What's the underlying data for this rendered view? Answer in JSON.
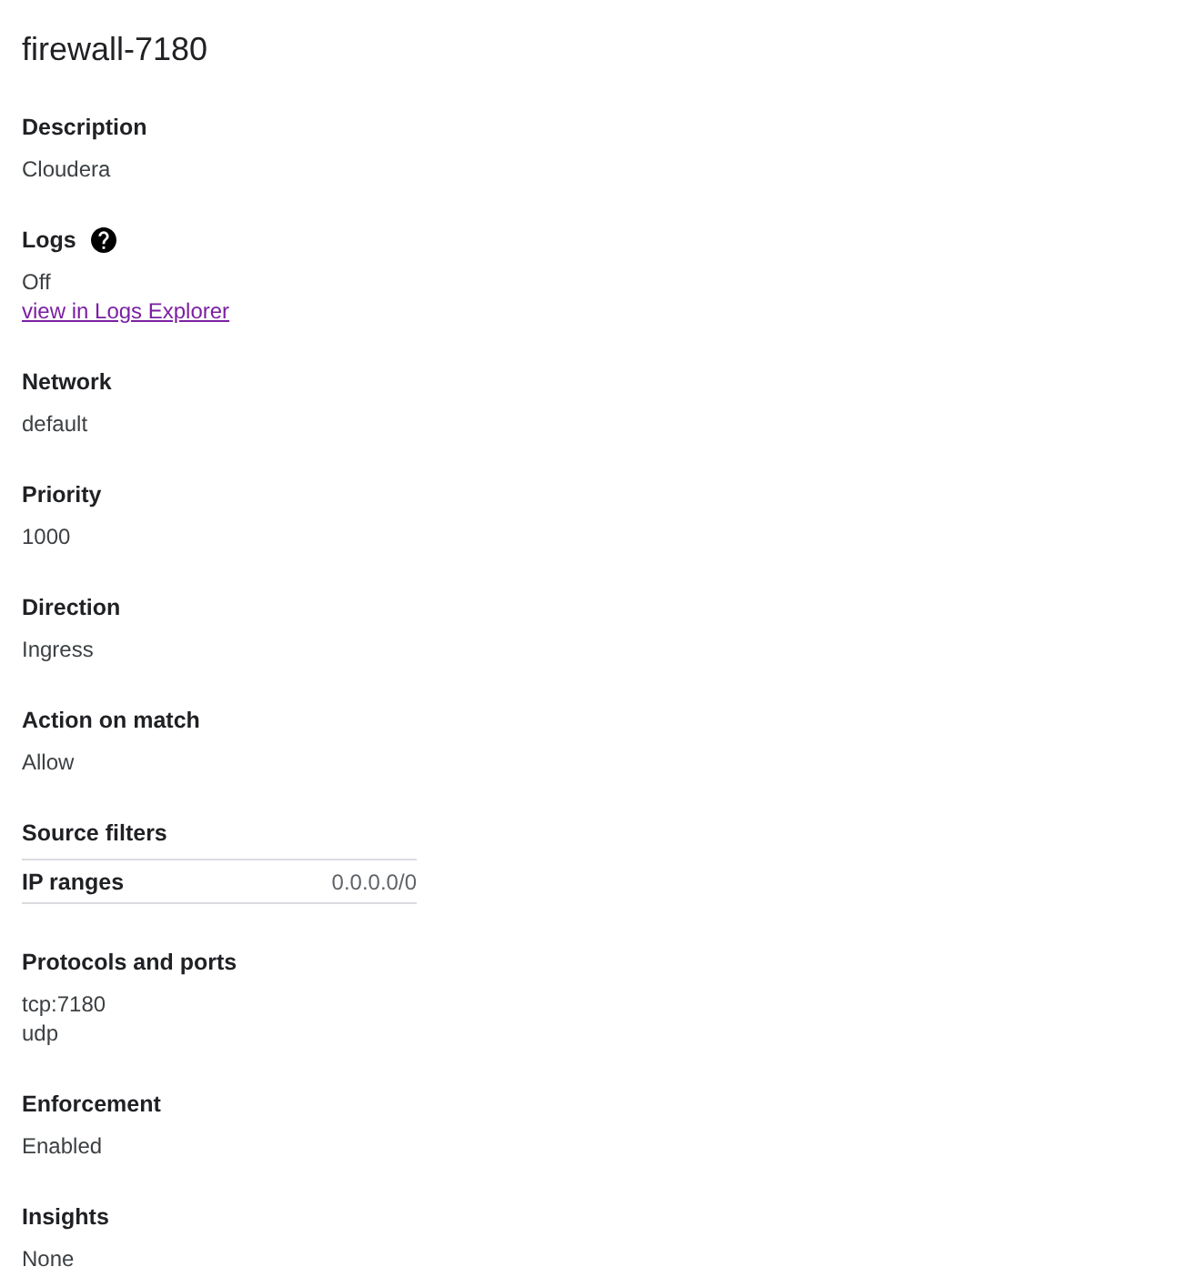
{
  "title": "firewall-7180",
  "fields": [
    {
      "kind": "text",
      "label": "Description",
      "values": [
        "Cloudera"
      ]
    },
    {
      "kind": "text",
      "label": "Logs",
      "help": true,
      "values": [
        "Off"
      ],
      "link": "view in Logs Explorer"
    },
    {
      "kind": "text",
      "label": "Network",
      "values": [
        "default"
      ]
    },
    {
      "kind": "text",
      "label": "Priority",
      "values": [
        "1000"
      ]
    },
    {
      "kind": "text",
      "label": "Direction",
      "values": [
        "Ingress"
      ]
    },
    {
      "kind": "text",
      "label": "Action on match",
      "values": [
        "Allow"
      ]
    },
    {
      "kind": "table",
      "label": "Source filters",
      "rows": [
        {
          "name": "IP ranges",
          "value": "0.0.0.0/0"
        }
      ]
    },
    {
      "kind": "text",
      "label": "Protocols and ports",
      "values": [
        "tcp:7180",
        "udp"
      ]
    },
    {
      "kind": "text",
      "label": "Enforcement",
      "values": [
        "Enabled"
      ]
    },
    {
      "kind": "text",
      "label": "Insights",
      "values": [
        "None"
      ]
    }
  ]
}
